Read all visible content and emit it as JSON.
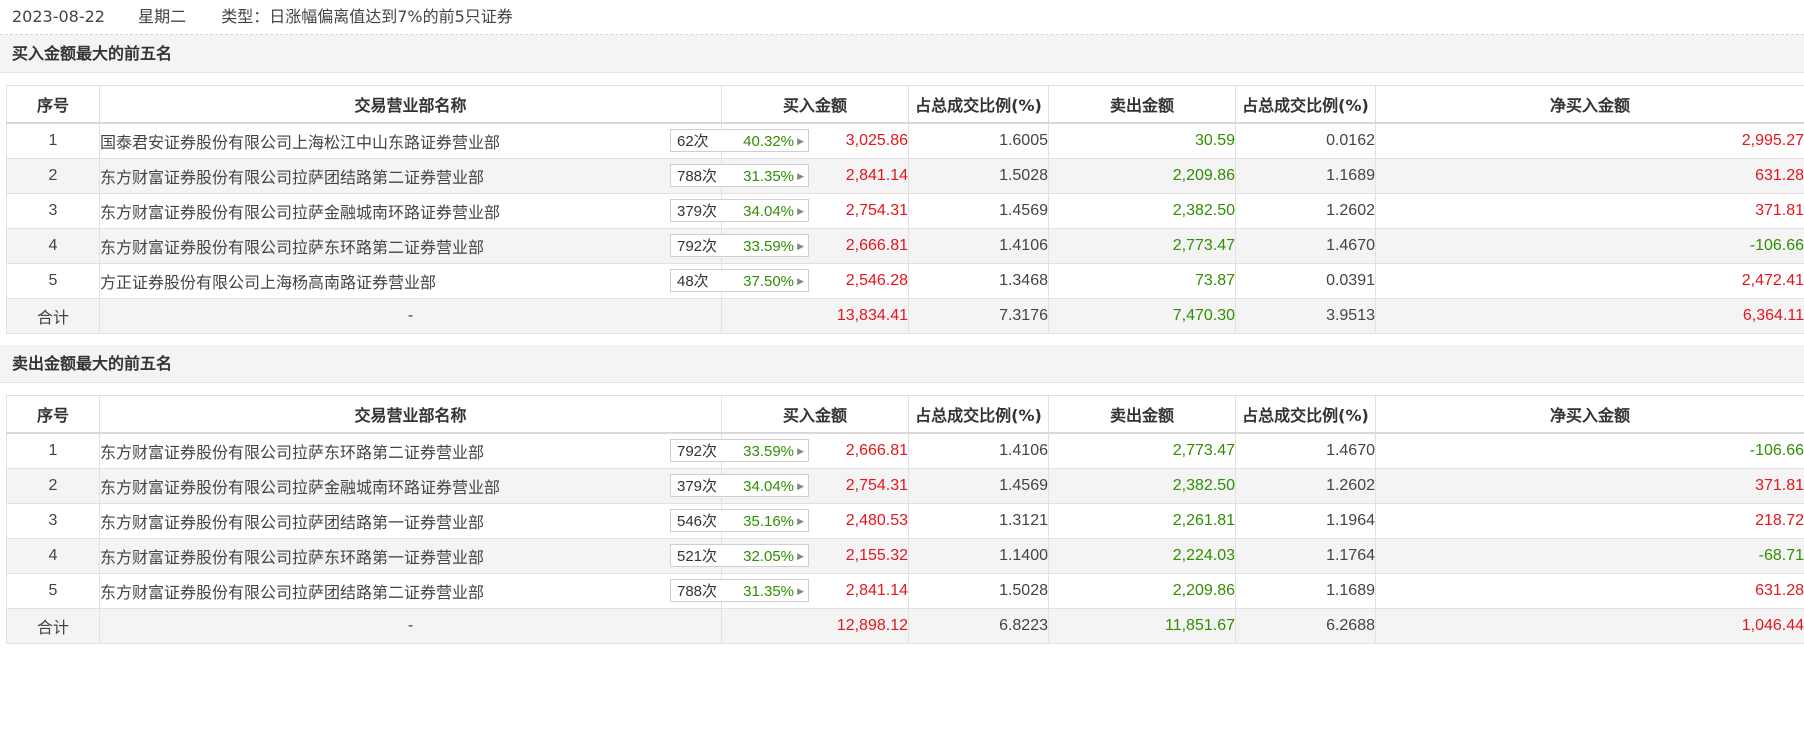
{
  "header": {
    "date": "2023-08-22",
    "weekday": "星期二",
    "type_text": "类型：日涨幅偏离值达到7%的前5只证券"
  },
  "columns": [
    "序号",
    "交易营业部名称",
    "买入金额",
    "占总成交比例(%)",
    "卖出金额",
    "占总成交比例(%)",
    "净买入金额"
  ],
  "buy_top5": {
    "title": "买入金额最大的前五名",
    "rows": [
      {
        "idx": "1",
        "name": "国泰君安证券股份有限公司上海松江中山东路证券营业部",
        "count": "62次",
        "pct": "40.32%",
        "buy": "3,025.86",
        "buy_ratio": "1.6005",
        "sell": "30.59",
        "sell_ratio": "0.0162",
        "net": "2,995.27",
        "net_sign": "pos"
      },
      {
        "idx": "2",
        "name": "东方财富证券股份有限公司拉萨团结路第二证券营业部",
        "count": "788次",
        "pct": "31.35%",
        "buy": "2,841.14",
        "buy_ratio": "1.5028",
        "sell": "2,209.86",
        "sell_ratio": "1.1689",
        "net": "631.28",
        "net_sign": "pos"
      },
      {
        "idx": "3",
        "name": "东方财富证券股份有限公司拉萨金融城南环路证券营业部",
        "count": "379次",
        "pct": "34.04%",
        "buy": "2,754.31",
        "buy_ratio": "1.4569",
        "sell": "2,382.50",
        "sell_ratio": "1.2602",
        "net": "371.81",
        "net_sign": "pos"
      },
      {
        "idx": "4",
        "name": "东方财富证券股份有限公司拉萨东环路第二证券营业部",
        "count": "792次",
        "pct": "33.59%",
        "buy": "2,666.81",
        "buy_ratio": "1.4106",
        "sell": "2,773.47",
        "sell_ratio": "1.4670",
        "net": "-106.66",
        "net_sign": "neg"
      },
      {
        "idx": "5",
        "name": "方正证券股份有限公司上海杨高南路证券营业部",
        "count": "48次",
        "pct": "37.50%",
        "buy": "2,546.28",
        "buy_ratio": "1.3468",
        "sell": "73.87",
        "sell_ratio": "0.0391",
        "net": "2,472.41",
        "net_sign": "pos"
      }
    ],
    "total": {
      "label": "合计",
      "name": "-",
      "buy": "13,834.41",
      "buy_ratio": "7.3176",
      "sell": "7,470.30",
      "sell_ratio": "3.9513",
      "net": "6,364.11",
      "net_sign": "pos"
    }
  },
  "sell_top5": {
    "title": "卖出金额最大的前五名",
    "rows": [
      {
        "idx": "1",
        "name": "东方财富证券股份有限公司拉萨东环路第二证券营业部",
        "count": "792次",
        "pct": "33.59%",
        "buy": "2,666.81",
        "buy_ratio": "1.4106",
        "sell": "2,773.47",
        "sell_ratio": "1.4670",
        "net": "-106.66",
        "net_sign": "neg"
      },
      {
        "idx": "2",
        "name": "东方财富证券股份有限公司拉萨金融城南环路证券营业部",
        "count": "379次",
        "pct": "34.04%",
        "buy": "2,754.31",
        "buy_ratio": "1.4569",
        "sell": "2,382.50",
        "sell_ratio": "1.2602",
        "net": "371.81",
        "net_sign": "pos"
      },
      {
        "idx": "3",
        "name": "东方财富证券股份有限公司拉萨团结路第一证券营业部",
        "count": "546次",
        "pct": "35.16%",
        "buy": "2,480.53",
        "buy_ratio": "1.3121",
        "sell": "2,261.81",
        "sell_ratio": "1.1964",
        "net": "218.72",
        "net_sign": "pos"
      },
      {
        "idx": "4",
        "name": "东方财富证券股份有限公司拉萨东环路第一证券营业部",
        "count": "521次",
        "pct": "32.05%",
        "buy": "2,155.32",
        "buy_ratio": "1.1400",
        "sell": "2,224.03",
        "sell_ratio": "1.1764",
        "net": "-68.71",
        "net_sign": "neg"
      },
      {
        "idx": "5",
        "name": "东方财富证券股份有限公司拉萨团结路第二证券营业部",
        "count": "788次",
        "pct": "31.35%",
        "buy": "2,841.14",
        "buy_ratio": "1.5028",
        "sell": "2,209.86",
        "sell_ratio": "1.1689",
        "net": "631.28",
        "net_sign": "pos"
      }
    ],
    "total": {
      "label": "合计",
      "name": "-",
      "buy": "12,898.12",
      "buy_ratio": "6.8223",
      "sell": "11,851.67",
      "sell_ratio": "6.2688",
      "net": "1,046.44",
      "net_sign": "pos"
    }
  },
  "colors": {
    "buy": "#e4151b",
    "sell": "#2f8f00",
    "badge_pct": "#2f8f00"
  },
  "icons": {
    "badge_arrow": "caret-right-icon"
  }
}
